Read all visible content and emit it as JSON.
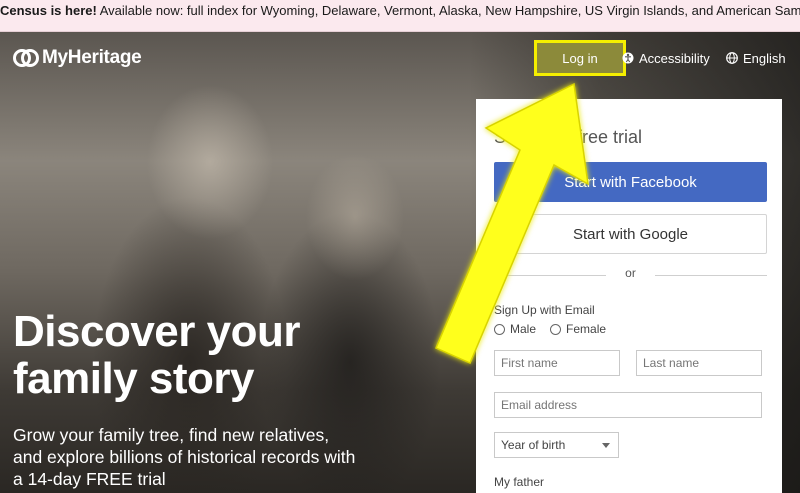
{
  "banner": {
    "bold": "Census is here!",
    "text": " Available now: full index for Wyoming, Delaware, Vermont, Alaska, New Hampshire, US Virgin Islands, and American Samoa"
  },
  "header": {
    "logo_text": "MyHeritage",
    "login_label": "Log in",
    "accessibility_label": "Accessibility",
    "language_label": "English"
  },
  "hero": {
    "headline_line1": "Discover your",
    "headline_line2": "family story",
    "subhead_line1": "Grow your family tree, find new relatives,",
    "subhead_line2": "and explore billions of historical records with",
    "subhead_line3": "a 14-day FREE trial"
  },
  "signup": {
    "title": "Start your free trial",
    "facebook_button": "Start with Facebook",
    "google_button": "Start with Google",
    "or": "or",
    "email_signup_label": "Sign Up with Email",
    "male_label": "Male",
    "female_label": "Female",
    "first_name_placeholder": "First name",
    "last_name_placeholder": "Last name",
    "email_placeholder": "Email address",
    "year_of_birth": "Year of birth",
    "my_father_label": "My father"
  },
  "colors": {
    "highlight": "#f5ef00",
    "facebook": "#4469c2",
    "banner_bg": "#fbe9ee"
  }
}
